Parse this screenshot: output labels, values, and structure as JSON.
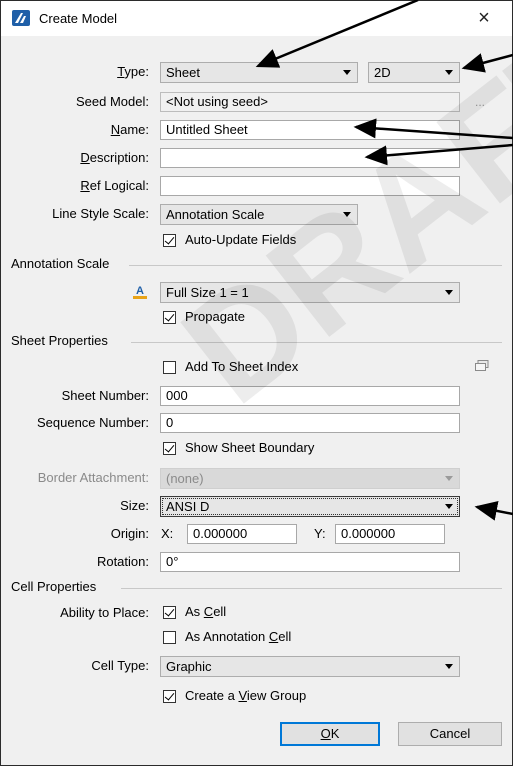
{
  "window": {
    "title": "Create Model",
    "close_glyph": "×"
  },
  "watermark": "DRAFT",
  "form": {
    "type_label_pre": "",
    "type_label_key": "T",
    "type_label_post": "ype:",
    "type_value": "Sheet",
    "dim_value": "2D",
    "seed_label": "Seed Model:",
    "seed_value": "<Not using seed>",
    "seed_ellipsis": "...",
    "name_label_key": "N",
    "name_label_post": "ame:",
    "name_value": "Untitled Sheet",
    "desc_label_key": "D",
    "desc_label_post": "escription:",
    "desc_value": "",
    "ref_label_key": "R",
    "ref_label_post": "ef Logical:",
    "ref_value": "",
    "linestyle_label": "Line Style Scale:",
    "linestyle_value": "Annotation Scale",
    "auto_update_label": "Auto-Update Fields",
    "auto_update_checked": true
  },
  "annotation": {
    "section_title": "Annotation Scale",
    "scale_value": "Full Size 1 = 1",
    "propagate_label": "Propagate",
    "propagate_checked": true
  },
  "sheet": {
    "section_title": "Sheet Properties",
    "add_index_label": "Add To Sheet Index",
    "add_index_checked": false,
    "number_label": "Sheet Number:",
    "number_value": "000",
    "sequence_label": "Sequence Number:",
    "sequence_value": "0",
    "boundary_label": "Show Sheet Boundary",
    "boundary_checked": true,
    "border_label": "Border Attachment:",
    "border_value": "(none)",
    "size_label": "Size:",
    "size_value": "ANSI D",
    "origin_label": "Origin:",
    "origin_x_label": "X:",
    "origin_x_value": "0.000000",
    "origin_y_label": "Y:",
    "origin_y_value": "0.000000",
    "rotation_label": "Rotation:",
    "rotation_value": "0°"
  },
  "cell": {
    "section_title": "Cell Properties",
    "ability_label": "Ability to Place:",
    "as_cell_pre": "As ",
    "as_cell_key": "C",
    "as_cell_post": "ell",
    "as_cell_checked": true,
    "as_annot_pre": "As Annotation ",
    "as_annot_key": "C",
    "as_annot_post": "ell",
    "as_annot_checked": false,
    "type_label": "Cell Type:",
    "type_value": "Graphic",
    "view_group_pre": "Create a ",
    "view_group_key": "V",
    "view_group_post": "iew Group",
    "view_group_checked": true
  },
  "buttons": {
    "ok_key": "O",
    "ok_post": "K",
    "cancel": "Cancel"
  },
  "colors": {
    "accent": "#0078d7",
    "app_icon": "#1f5fa8",
    "arrows": "#000000"
  }
}
